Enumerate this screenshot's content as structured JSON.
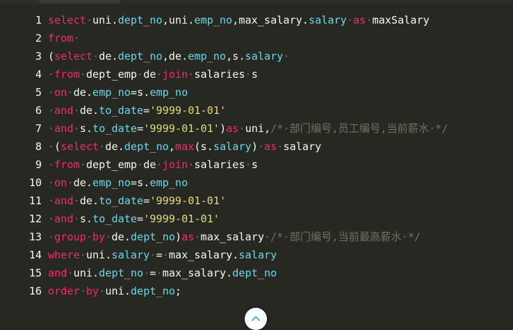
{
  "editor": {
    "lines": [
      {
        "num": "1",
        "tokens": [
          {
            "t": "select",
            "c": "kw"
          },
          {
            "t": "·",
            "c": "cmt"
          },
          {
            "t": "uni.",
            "c": "pl"
          },
          {
            "t": "dept_no",
            "c": "fld"
          },
          {
            "t": ",uni.",
            "c": "pl"
          },
          {
            "t": "emp_no",
            "c": "fld"
          },
          {
            "t": ",max_salary.",
            "c": "pl"
          },
          {
            "t": "salary",
            "c": "fld"
          },
          {
            "t": "·",
            "c": "cmt"
          },
          {
            "t": "as",
            "c": "kw"
          },
          {
            "t": "·",
            "c": "cmt"
          },
          {
            "t": "maxSalary",
            "c": "pl"
          }
        ]
      },
      {
        "num": "2",
        "tokens": [
          {
            "t": "from",
            "c": "kw"
          },
          {
            "t": "·",
            "c": "cmt"
          }
        ]
      },
      {
        "num": "3",
        "tokens": [
          {
            "t": "(",
            "c": "pl"
          },
          {
            "t": "select",
            "c": "kw"
          },
          {
            "t": "·",
            "c": "cmt"
          },
          {
            "t": "de.",
            "c": "pl"
          },
          {
            "t": "dept_no",
            "c": "fld"
          },
          {
            "t": ",de.",
            "c": "pl"
          },
          {
            "t": "emp_no",
            "c": "fld"
          },
          {
            "t": ",s.",
            "c": "pl"
          },
          {
            "t": "salary",
            "c": "fld"
          },
          {
            "t": "·",
            "c": "cmt"
          }
        ]
      },
      {
        "num": "4",
        "tokens": [
          {
            "t": "·",
            "c": "cmt"
          },
          {
            "t": "from",
            "c": "kw"
          },
          {
            "t": "·",
            "c": "cmt"
          },
          {
            "t": "dept_emp",
            "c": "pl"
          },
          {
            "t": "·",
            "c": "cmt"
          },
          {
            "t": "de",
            "c": "pl"
          },
          {
            "t": "·",
            "c": "cmt"
          },
          {
            "t": "join",
            "c": "kw"
          },
          {
            "t": "·",
            "c": "cmt"
          },
          {
            "t": "salaries",
            "c": "pl"
          },
          {
            "t": "·",
            "c": "cmt"
          },
          {
            "t": "s",
            "c": "pl"
          }
        ]
      },
      {
        "num": "5",
        "tokens": [
          {
            "t": "·",
            "c": "cmt"
          },
          {
            "t": "on",
            "c": "kw"
          },
          {
            "t": "·",
            "c": "cmt"
          },
          {
            "t": "de.",
            "c": "pl"
          },
          {
            "t": "emp_no",
            "c": "fld"
          },
          {
            "t": "=s.",
            "c": "pl"
          },
          {
            "t": "emp_no",
            "c": "fld"
          }
        ]
      },
      {
        "num": "6",
        "tokens": [
          {
            "t": "·",
            "c": "cmt"
          },
          {
            "t": "and",
            "c": "kw"
          },
          {
            "t": "·",
            "c": "cmt"
          },
          {
            "t": "de.",
            "c": "pl"
          },
          {
            "t": "to_date",
            "c": "fld"
          },
          {
            "t": "=",
            "c": "pl"
          },
          {
            "t": "'9999-01-01'",
            "c": "str"
          }
        ]
      },
      {
        "num": "7",
        "tokens": [
          {
            "t": "·",
            "c": "cmt"
          },
          {
            "t": "and",
            "c": "kw"
          },
          {
            "t": "·",
            "c": "cmt"
          },
          {
            "t": "s.",
            "c": "pl"
          },
          {
            "t": "to_date",
            "c": "fld"
          },
          {
            "t": "=",
            "c": "pl"
          },
          {
            "t": "'9999-01-01'",
            "c": "str"
          },
          {
            "t": ")",
            "c": "pl"
          },
          {
            "t": "as",
            "c": "kw"
          },
          {
            "t": "·",
            "c": "cmt"
          },
          {
            "t": "uni,",
            "c": "pl"
          },
          {
            "t": "/*·部门编号,员工编号,当前薪水·*/",
            "c": "cmt"
          }
        ]
      },
      {
        "num": "8",
        "tokens": [
          {
            "t": "·",
            "c": "cmt"
          },
          {
            "t": "(",
            "c": "pl"
          },
          {
            "t": "select",
            "c": "kw"
          },
          {
            "t": "·",
            "c": "cmt"
          },
          {
            "t": "de.",
            "c": "pl"
          },
          {
            "t": "dept_no",
            "c": "fld"
          },
          {
            "t": ",",
            "c": "pl"
          },
          {
            "t": "max",
            "c": "kw"
          },
          {
            "t": "(s.",
            "c": "pl"
          },
          {
            "t": "salary",
            "c": "fld"
          },
          {
            "t": ")",
            "c": "pl"
          },
          {
            "t": "·",
            "c": "cmt"
          },
          {
            "t": "as",
            "c": "kw"
          },
          {
            "t": "·",
            "c": "cmt"
          },
          {
            "t": "salary",
            "c": "pl"
          }
        ]
      },
      {
        "num": "9",
        "tokens": [
          {
            "t": "·",
            "c": "cmt"
          },
          {
            "t": "from",
            "c": "kw"
          },
          {
            "t": "·",
            "c": "cmt"
          },
          {
            "t": "dept_emp",
            "c": "pl"
          },
          {
            "t": "·",
            "c": "cmt"
          },
          {
            "t": "de",
            "c": "pl"
          },
          {
            "t": "·",
            "c": "cmt"
          },
          {
            "t": "join",
            "c": "kw"
          },
          {
            "t": "·",
            "c": "cmt"
          },
          {
            "t": "salaries",
            "c": "pl"
          },
          {
            "t": "·",
            "c": "cmt"
          },
          {
            "t": "s",
            "c": "pl"
          }
        ]
      },
      {
        "num": "10",
        "tokens": [
          {
            "t": "·",
            "c": "cmt"
          },
          {
            "t": "on",
            "c": "kw"
          },
          {
            "t": "·",
            "c": "cmt"
          },
          {
            "t": "de.",
            "c": "pl"
          },
          {
            "t": "emp_no",
            "c": "fld"
          },
          {
            "t": "=s.",
            "c": "pl"
          },
          {
            "t": "emp_no",
            "c": "fld"
          }
        ]
      },
      {
        "num": "11",
        "tokens": [
          {
            "t": "·",
            "c": "cmt"
          },
          {
            "t": "and",
            "c": "kw"
          },
          {
            "t": "·",
            "c": "cmt"
          },
          {
            "t": "de.",
            "c": "pl"
          },
          {
            "t": "to_date",
            "c": "fld"
          },
          {
            "t": "=",
            "c": "pl"
          },
          {
            "t": "'9999-01-01'",
            "c": "str"
          }
        ]
      },
      {
        "num": "12",
        "tokens": [
          {
            "t": "·",
            "c": "cmt"
          },
          {
            "t": "and",
            "c": "kw"
          },
          {
            "t": "·",
            "c": "cmt"
          },
          {
            "t": "s.",
            "c": "pl"
          },
          {
            "t": "to_date",
            "c": "fld"
          },
          {
            "t": "=",
            "c": "pl"
          },
          {
            "t": "'9999-01-01'",
            "c": "str"
          }
        ]
      },
      {
        "num": "13",
        "tokens": [
          {
            "t": "·",
            "c": "cmt"
          },
          {
            "t": "group",
            "c": "kw"
          },
          {
            "t": "·",
            "c": "cmt"
          },
          {
            "t": "by",
            "c": "kw"
          },
          {
            "t": "·",
            "c": "cmt"
          },
          {
            "t": "de.",
            "c": "pl"
          },
          {
            "t": "dept_no",
            "c": "fld"
          },
          {
            "t": ")",
            "c": "pl"
          },
          {
            "t": "as",
            "c": "kw"
          },
          {
            "t": "·",
            "c": "cmt"
          },
          {
            "t": "max_salary",
            "c": "pl"
          },
          {
            "t": "·",
            "c": "cmt"
          },
          {
            "t": "/*·部门编号,当前最高薪水·*/",
            "c": "cmt"
          }
        ]
      },
      {
        "num": "14",
        "tokens": [
          {
            "t": "where",
            "c": "kw"
          },
          {
            "t": "·",
            "c": "cmt"
          },
          {
            "t": "uni.",
            "c": "pl"
          },
          {
            "t": "salary",
            "c": "fld"
          },
          {
            "t": "·",
            "c": "cmt"
          },
          {
            "t": "=",
            "c": "pl"
          },
          {
            "t": "·",
            "c": "cmt"
          },
          {
            "t": "max_salary.",
            "c": "pl"
          },
          {
            "t": "salary",
            "c": "fld"
          }
        ]
      },
      {
        "num": "15",
        "tokens": [
          {
            "t": "and",
            "c": "kw"
          },
          {
            "t": "·",
            "c": "cmt"
          },
          {
            "t": "uni.",
            "c": "pl"
          },
          {
            "t": "dept_no",
            "c": "fld"
          },
          {
            "t": "·",
            "c": "cmt"
          },
          {
            "t": "=",
            "c": "pl"
          },
          {
            "t": "·",
            "c": "cmt"
          },
          {
            "t": "max_salary.",
            "c": "pl"
          },
          {
            "t": "dept_no",
            "c": "fld"
          }
        ]
      },
      {
        "num": "16",
        "tokens": [
          {
            "t": "order",
            "c": "kw"
          },
          {
            "t": "·",
            "c": "cmt"
          },
          {
            "t": "by",
            "c": "kw"
          },
          {
            "t": "·",
            "c": "cmt"
          },
          {
            "t": "uni.",
            "c": "pl"
          },
          {
            "t": "dept_no",
            "c": "fld"
          },
          {
            "t": ";",
            "c": "pl"
          }
        ]
      }
    ]
  },
  "collapse_button": {
    "icon": "chevron-up-icon"
  },
  "colors": {
    "background": "#272822",
    "keyword": "#f92672",
    "field": "#66d9ef",
    "string": "#e6db74",
    "comment": "#75715e",
    "plain": "#f8f8f2",
    "line_number": "#f8f8f2"
  }
}
